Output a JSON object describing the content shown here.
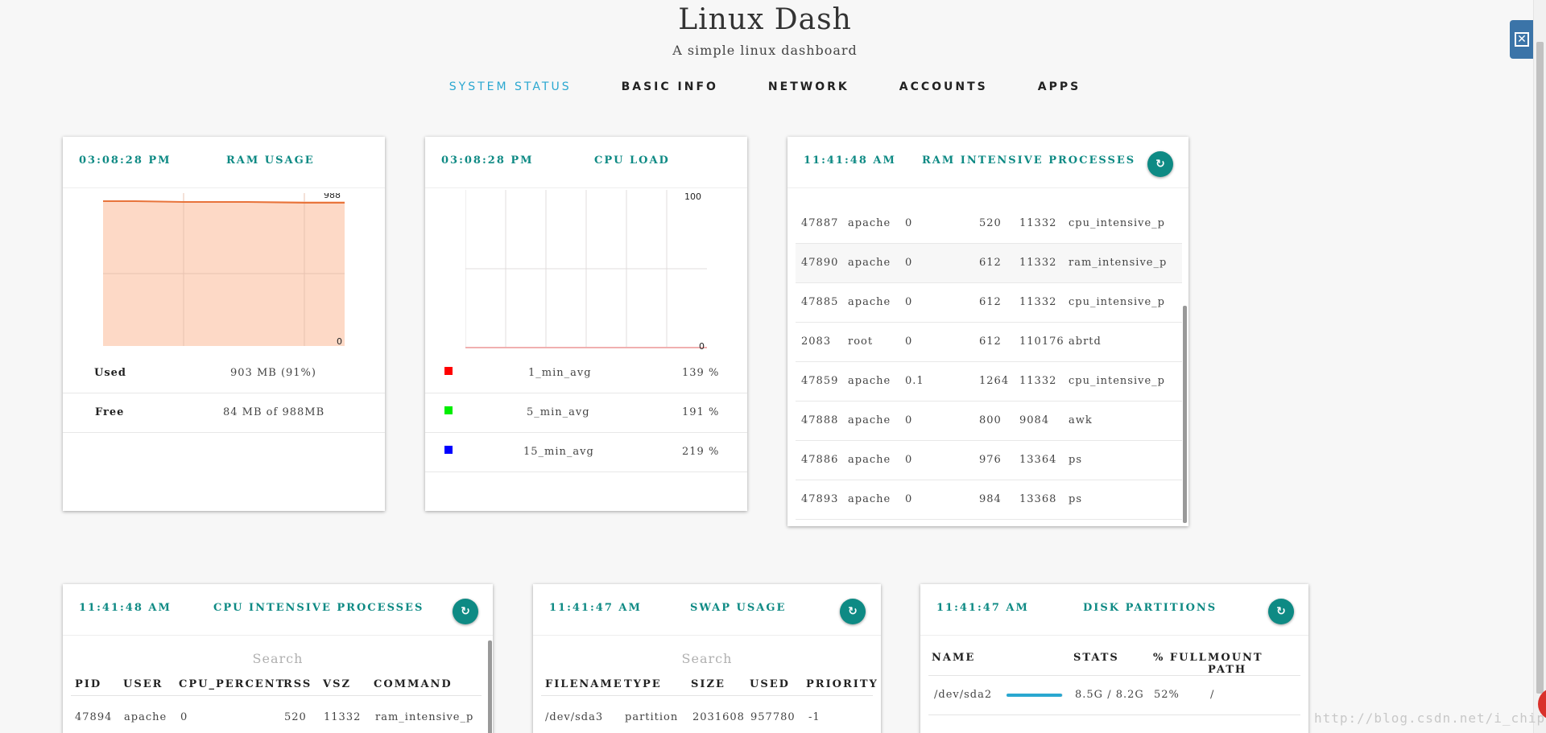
{
  "header": {
    "title": "Linux Dash",
    "subtitle": "A simple linux dashboard"
  },
  "nav": {
    "items": [
      "SYSTEM STATUS",
      "BASIC INFO",
      "NETWORK",
      "ACCOUNTS",
      "APPS"
    ],
    "active": "SYSTEM STATUS"
  },
  "colors": {
    "accent": "#0e8a84",
    "nav_active": "#2aa7d0",
    "ram_fill": "#fdd9c6",
    "ram_line": "#e8743b",
    "legend_1min": "#ff0000",
    "legend_5min": "#00ee00",
    "legend_15min": "#0000ff",
    "disk_bar": "#2aa7d0"
  },
  "ram_usage": {
    "time": "03:08:28 PM",
    "title": "RAM USAGE",
    "y_max_label": "988",
    "y_min_label": "0",
    "used_label": "Used",
    "used_value": "903 MB (91%)",
    "free_label": "Free",
    "free_value": "84 MB of 988MB"
  },
  "cpu_load": {
    "time": "03:08:28 PM",
    "title": "CPU LOAD",
    "y_max_label": "100",
    "y_min_label": "0",
    "rows": [
      {
        "label": "1_min_avg",
        "value": "139 %"
      },
      {
        "label": "5_min_avg",
        "value": "191 %"
      },
      {
        "label": "15_min_avg",
        "value": "219 %"
      }
    ]
  },
  "ram_processes": {
    "time": "11:41:48 AM",
    "title": "RAM INTENSIVE PROCESSES",
    "refresh_icon": "refresh-icon",
    "rows": [
      [
        "47887",
        "apache",
        "0",
        "520",
        "11332",
        "cpu_intensive_p"
      ],
      [
        "47890",
        "apache",
        "0",
        "612",
        "11332",
        "ram_intensive_p"
      ],
      [
        "47885",
        "apache",
        "0",
        "612",
        "11332",
        "cpu_intensive_p"
      ],
      [
        "2083",
        "root",
        "0",
        "612",
        "110176",
        "abrtd"
      ],
      [
        "47859",
        "apache",
        "0.1",
        "1264",
        "11332",
        "cpu_intensive_p"
      ],
      [
        "47888",
        "apache",
        "0",
        "800",
        "9084",
        "awk"
      ],
      [
        "47886",
        "apache",
        "0",
        "976",
        "13364",
        "ps"
      ],
      [
        "47893",
        "apache",
        "0",
        "984",
        "13368",
        "ps"
      ]
    ]
  },
  "cpu_processes": {
    "time": "11:41:48 AM",
    "title": "CPU INTENSIVE PROCESSES",
    "search_placeholder": "Search",
    "columns": [
      "PID",
      "USER",
      "CPU_PERCENT",
      "RSS",
      "VSZ",
      "COMMAND"
    ],
    "rows": [
      [
        "47894",
        "apache",
        "0",
        "520",
        "11332",
        "ram_intensive_p"
      ]
    ]
  },
  "swap_usage": {
    "time": "11:41:47 AM",
    "title": "SWAP USAGE",
    "search_placeholder": "Search",
    "columns": [
      "FILENAME",
      "TYPE",
      "SIZE",
      "USED",
      "PRIORITY"
    ],
    "rows": [
      [
        "/dev/sda3",
        "partition",
        "2031608",
        "957780",
        "-1"
      ]
    ]
  },
  "disk_partitions": {
    "time": "11:41:47 AM",
    "title": "DISK PARTITIONS",
    "columns": [
      "NAME",
      "STATS",
      "% FULL",
      "MOUNT PATH"
    ],
    "rows": [
      {
        "name": "/dev/sda2",
        "fill_percent": 52,
        "stats": "8.5G / 8.2G",
        "full": "52%",
        "mount": "/"
      }
    ]
  },
  "watermark": "http://blog.csdn.net/i_chips"
}
